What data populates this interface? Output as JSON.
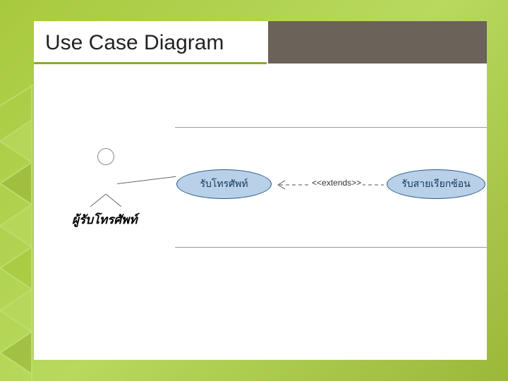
{
  "slide": {
    "title": "Use Case Diagram"
  },
  "diagram": {
    "actor_label": "ผู้รับโทรศัพท์",
    "usecase1": "รับโทรศัพท์",
    "usecase2": "รับสายเรียกซ้อน",
    "extends_label": "<<extends>>"
  }
}
